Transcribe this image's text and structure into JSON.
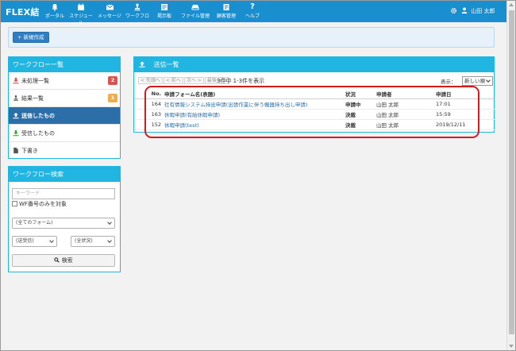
{
  "app": {
    "logo": "FLEX結"
  },
  "nav": {
    "items": [
      {
        "label": "ポータル",
        "icon": "bell-icon"
      },
      {
        "label": "スケジュール",
        "icon": "calendar-icon"
      },
      {
        "label": "メッセージ",
        "icon": "envelope-icon"
      },
      {
        "label": "ワークフロー",
        "icon": "stamp-icon"
      },
      {
        "label": "掲示板",
        "icon": "board-icon"
      },
      {
        "label": "ファイル管理",
        "icon": "hdd-icon"
      },
      {
        "label": "顧客管理",
        "icon": "customer-icon"
      },
      {
        "label": "ヘルプ",
        "icon": "question-icon"
      }
    ],
    "user_name": "山田 太郎",
    "user_icon": "user-icon",
    "settings_icon": "gear-icon"
  },
  "toolbar": {
    "new_button": "+ 新規作成"
  },
  "workflow_list": {
    "title": "ワークフロー一覧",
    "items": [
      {
        "label": "未処理一覧",
        "icon": "download-icon",
        "badge": "2",
        "badge_color": "#d9534f"
      },
      {
        "label": "結果一覧",
        "icon": "stamp-icon",
        "badge": "1",
        "badge_color": "#f0ad4e"
      },
      {
        "label": "送信したもの",
        "icon": "upload-icon",
        "active": true
      },
      {
        "label": "受信したもの",
        "icon": "download-icon"
      },
      {
        "label": "下書き",
        "icon": "file-icon"
      }
    ]
  },
  "workflow_search": {
    "title": "ワークフロー検索",
    "keyword_placeholder": "キーワード",
    "wf_only_label": "WF番号のみを対象",
    "form_select": "(全てのフォーム)",
    "sendrecv_select": "(送受信)",
    "status_select": "(全状況)",
    "search_button": "検索"
  },
  "sent": {
    "title": "送信一覧",
    "pager": {
      "first": "< 先頭へ",
      "prev": "< 前へ",
      "next": "次へ >",
      "last": "最後へ >"
    },
    "count": "3件中 1-3件を表示",
    "display_label": "表示：",
    "order": "新しい順",
    "columns": {
      "no": "No.",
      "form": "申請フォーム名(表題)",
      "status": "状況",
      "applicant": "申請者",
      "date": "申請日"
    },
    "rows": [
      {
        "no": "164",
        "form": "社有情報システム持出申請(出張作業に伴う機器持ち出し申請)",
        "status": "申請中",
        "status_color": "#1a7fd0",
        "applicant": "山田 太郎",
        "date": "17:01"
      },
      {
        "no": "163",
        "form": "休暇申請(有給休暇申請)",
        "status": "決裁",
        "status_color": "#2a9a3a",
        "applicant": "山田 太郎",
        "date": "15:59"
      },
      {
        "no": "152",
        "form": "休暇申請(test)",
        "status": "決裁",
        "status_color": "#2a9a3a",
        "applicant": "山田 太郎",
        "date": "2019/12/11"
      }
    ]
  },
  "colors": {
    "nav": "#1a8fd0",
    "panel_header": "#21b5e2",
    "active_item": "#2c6ea8",
    "annotation": "#d41b1b"
  }
}
